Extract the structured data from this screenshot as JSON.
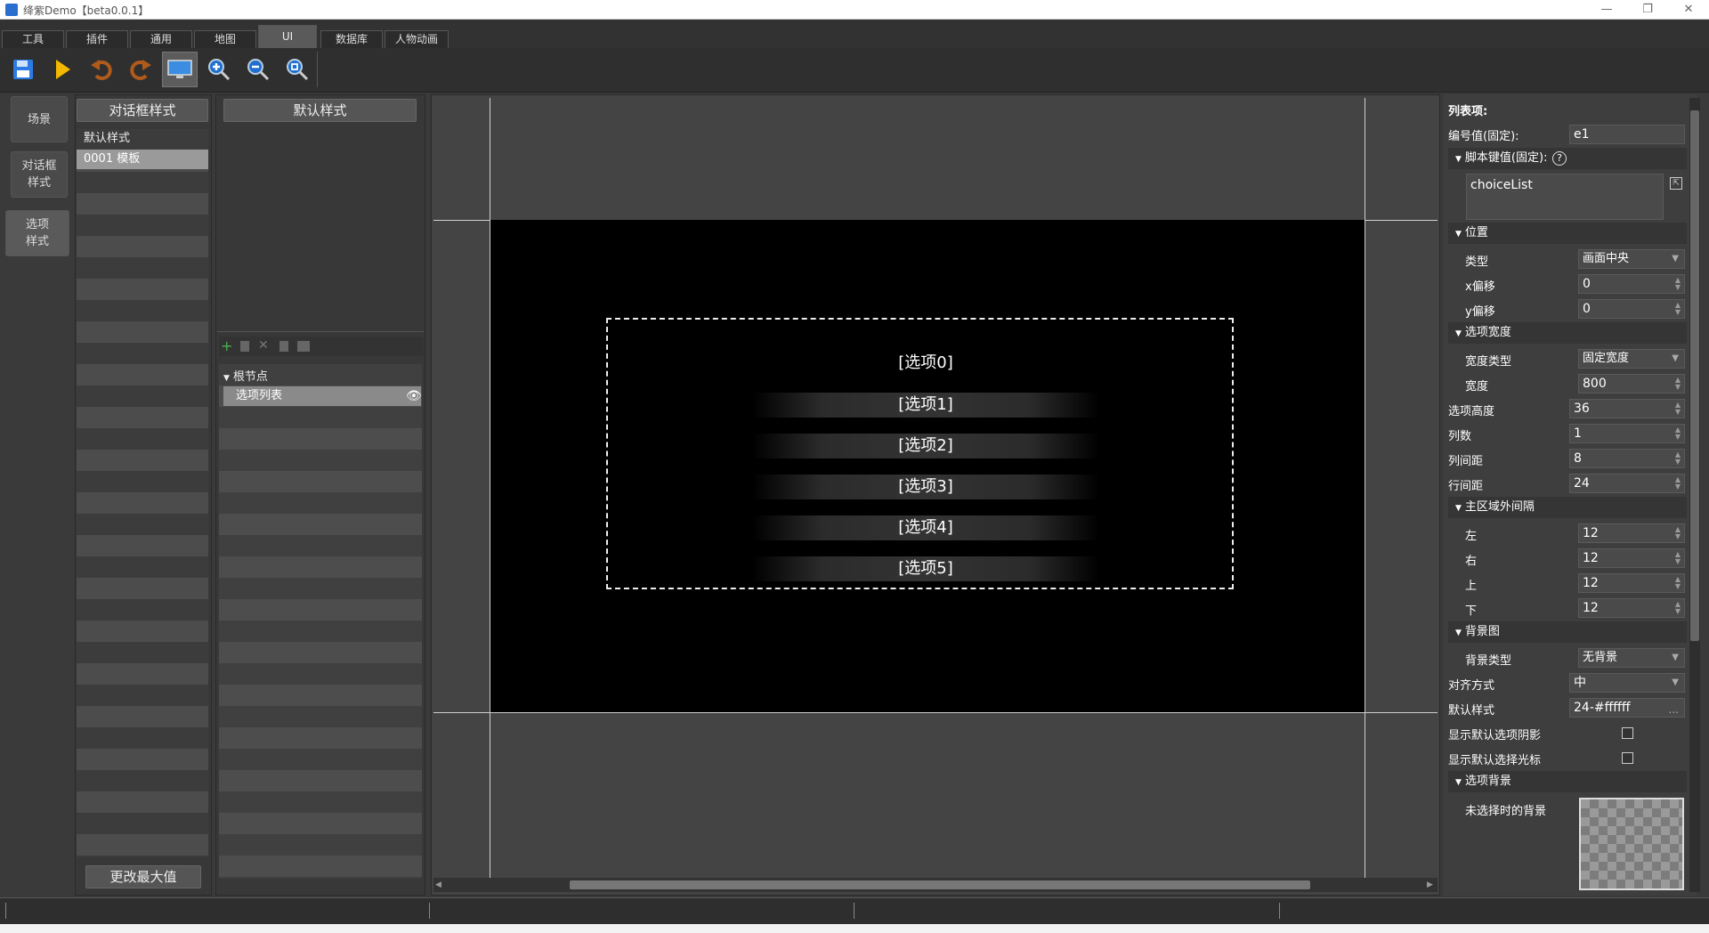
{
  "window": {
    "title": "绛紫Demo【beta0.0.1】",
    "min": "—",
    "max": "❐",
    "close": "✕"
  },
  "tabs": [
    "工具",
    "插件",
    "通用",
    "地图",
    "UI",
    "数据库",
    "人物动画"
  ],
  "toolbar": {
    "icons": [
      "save-icon",
      "play-icon",
      "undo-icon",
      "redo-icon",
      "monitor-icon",
      "zoom-in-icon",
      "zoom-out-icon",
      "zoom-reset-icon"
    ]
  },
  "side_tabs": [
    "场景",
    "对话框\n样式",
    "选项\n样式"
  ],
  "style_list": {
    "header": "对话框样式",
    "group": "默认样式",
    "item": "0001   模板",
    "bottom_button": "更改最大值"
  },
  "node_panel": {
    "header": "默认样式",
    "root": "根节点",
    "child": "选项列表"
  },
  "preview": {
    "options": [
      "[选项0]",
      "[选项1]",
      "[选项2]",
      "[选项3]",
      "[选项4]",
      "[选项5]"
    ]
  },
  "props": {
    "title": "列表项:",
    "id_label": "编号值(固定):",
    "id_value": "e1",
    "script_key_label": "脚本键值(固定):",
    "script_key_help": "?",
    "script_key_value": "choiceList",
    "pos_section": "位置",
    "pos_type_label": "类型",
    "pos_type_value": "画面中央",
    "xoff_label": "x偏移",
    "xoff_value": "0",
    "yoff_label": "y偏移",
    "yoff_value": "0",
    "width_section": "选项宽度",
    "width_type_label": "宽度类型",
    "width_type_value": "固定宽度",
    "width_label": "宽度",
    "width_value": "800",
    "height_label": "选项高度",
    "height_value": "36",
    "cols_label": "列数",
    "cols_value": "1",
    "colgap_label": "列间距",
    "colgap_value": "8",
    "rowgap_label": "行间距",
    "rowgap_value": "24",
    "margin_section": "主区域外间隔",
    "left_label": "左",
    "left_value": "12",
    "right_label": "右",
    "right_value": "12",
    "top_label": "上",
    "top_value": "12",
    "bottom_label": "下",
    "bottom_value": "12",
    "bg_section": "背景图",
    "bg_type_label": "背景类型",
    "bg_type_value": "无背景",
    "align_label": "对齐方式",
    "align_value": "中",
    "default_style_label": "默认样式",
    "default_style_value": "24-#ffffff",
    "default_style_more": "...",
    "show_shadow_label": "显示默认选项阴影",
    "show_cursor_label": "显示默认选择光标",
    "opt_bg_section": "选项背景",
    "unselected_bg_label": "未选择时的背景"
  }
}
